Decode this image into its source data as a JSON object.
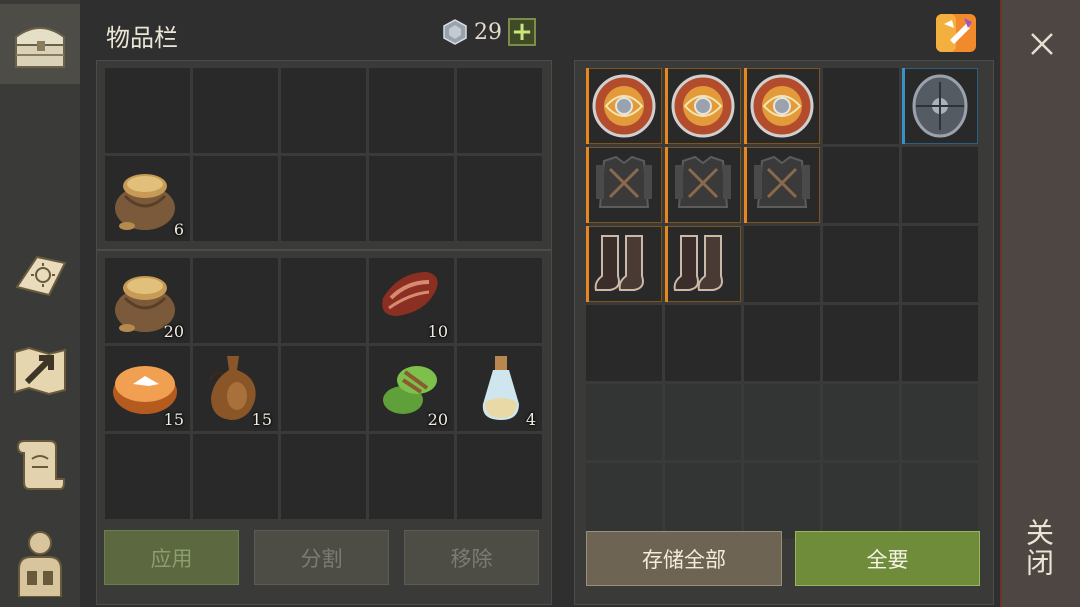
{
  "title": "物品栏",
  "currency": {
    "value": "29",
    "plus_label": "+"
  },
  "sidebar": {
    "items": [
      {
        "name": "inventory-chest"
      },
      {
        "name": "crafting-book"
      },
      {
        "name": "map"
      },
      {
        "name": "quest-scroll"
      },
      {
        "name": "character"
      }
    ]
  },
  "inventory": {
    "quick_grid": [
      {
        "icon": "",
        "qty": ""
      },
      {
        "icon": "",
        "qty": ""
      },
      {
        "icon": "",
        "qty": ""
      },
      {
        "icon": "",
        "qty": ""
      },
      {
        "icon": "",
        "qty": ""
      },
      {
        "icon": "sack-icon",
        "qty": "6"
      },
      {
        "icon": "",
        "qty": ""
      },
      {
        "icon": "",
        "qty": ""
      },
      {
        "icon": "",
        "qty": ""
      },
      {
        "icon": "",
        "qty": ""
      }
    ],
    "main_grid": [
      {
        "icon": "sack-icon",
        "qty": "20"
      },
      {
        "icon": "",
        "qty": ""
      },
      {
        "icon": "",
        "qty": ""
      },
      {
        "icon": "meat-icon",
        "qty": "10"
      },
      {
        "icon": "",
        "qty": ""
      },
      {
        "icon": "pie-icon",
        "qty": "15"
      },
      {
        "icon": "flask-icon",
        "qty": "15"
      },
      {
        "icon": "",
        "qty": ""
      },
      {
        "icon": "herb-wrap-icon",
        "qty": "20"
      },
      {
        "icon": "potion-icon",
        "qty": "4"
      },
      {
        "icon": "",
        "qty": ""
      },
      {
        "icon": "",
        "qty": ""
      },
      {
        "icon": "",
        "qty": ""
      },
      {
        "icon": "",
        "qty": ""
      },
      {
        "icon": "",
        "qty": ""
      }
    ],
    "buttons": {
      "apply": "应用",
      "split": "分割",
      "remove": "移除"
    }
  },
  "storage": {
    "grid": [
      {
        "icon": "round-shield-icon",
        "rarity": "orange"
      },
      {
        "icon": "round-shield-icon",
        "rarity": "orange"
      },
      {
        "icon": "round-shield-icon",
        "rarity": "orange"
      },
      {
        "icon": "",
        "rarity": ""
      },
      {
        "icon": "iron-shield-icon",
        "rarity": "blue"
      },
      {
        "icon": "armor-icon",
        "rarity": "orange"
      },
      {
        "icon": "armor-icon",
        "rarity": "orange"
      },
      {
        "icon": "armor-icon",
        "rarity": "orange"
      },
      {
        "icon": "",
        "rarity": ""
      },
      {
        "icon": "",
        "rarity": ""
      },
      {
        "icon": "boots-icon",
        "rarity": "orange"
      },
      {
        "icon": "boots-icon",
        "rarity": "orange"
      },
      {
        "icon": "",
        "rarity": ""
      },
      {
        "icon": "",
        "rarity": ""
      },
      {
        "icon": "",
        "rarity": ""
      },
      {
        "icon": "",
        "rarity": ""
      },
      {
        "icon": "",
        "rarity": ""
      },
      {
        "icon": "",
        "rarity": ""
      },
      {
        "icon": "",
        "rarity": ""
      },
      {
        "icon": "",
        "rarity": ""
      },
      {
        "icon": "",
        "rarity": "",
        "dim": true
      },
      {
        "icon": "",
        "rarity": "",
        "dim": true
      },
      {
        "icon": "",
        "rarity": "",
        "dim": true
      },
      {
        "icon": "",
        "rarity": "",
        "dim": true
      },
      {
        "icon": "",
        "rarity": "",
        "dim": true
      },
      {
        "icon": "",
        "rarity": "",
        "dim": true
      },
      {
        "icon": "",
        "rarity": "",
        "dim": true
      },
      {
        "icon": "",
        "rarity": "",
        "dim": true
      },
      {
        "icon": "",
        "rarity": "",
        "dim": true
      },
      {
        "icon": "",
        "rarity": "",
        "dim": true
      }
    ],
    "buttons": {
      "store_all": "存储全部",
      "take_all": "全要"
    }
  },
  "close": {
    "label": "关闭"
  },
  "colors": {
    "orange": "#e8871f",
    "blue": "#3a8fc7"
  }
}
